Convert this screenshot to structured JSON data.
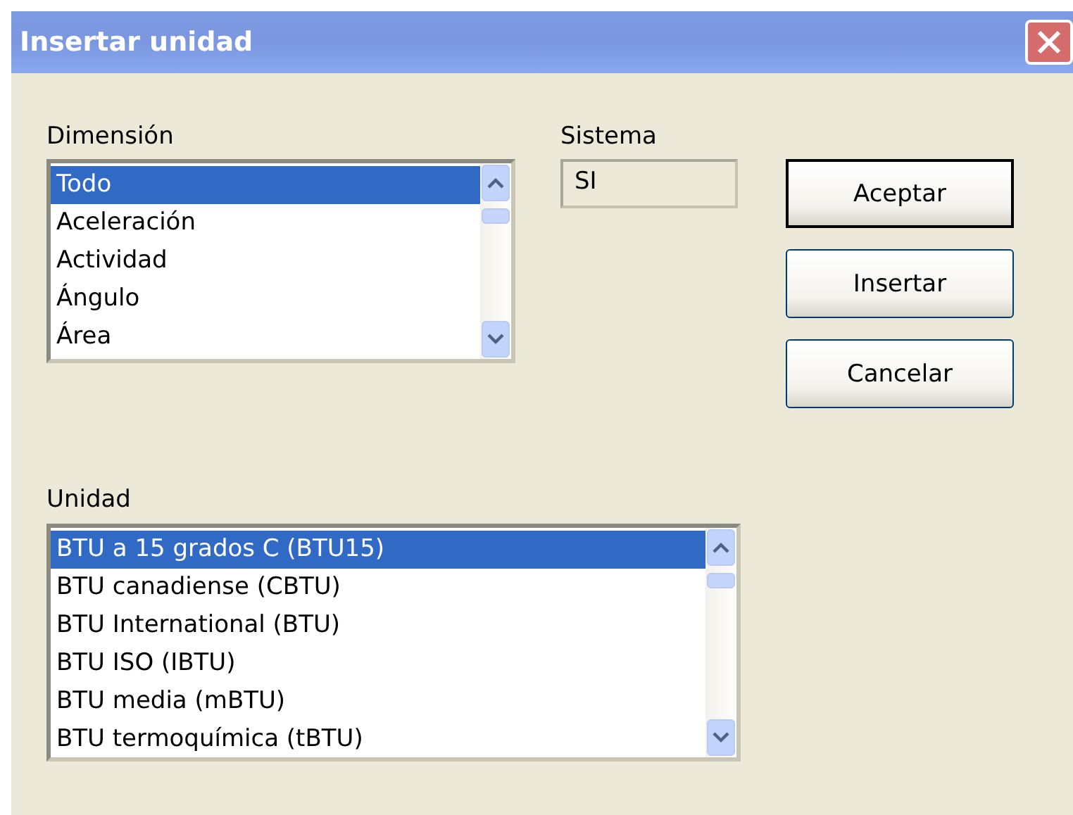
{
  "window": {
    "title": "Insertar unidad"
  },
  "dimension": {
    "label": "Dimensión",
    "items": [
      {
        "label": "Todo",
        "selected": true
      },
      {
        "label": "Aceleración",
        "selected": false
      },
      {
        "label": "Actividad",
        "selected": false
      },
      {
        "label": "Ángulo",
        "selected": false
      },
      {
        "label": "Área",
        "selected": false
      }
    ]
  },
  "system": {
    "label": "Sistema",
    "value": "SI"
  },
  "buttons": [
    {
      "label": "Aceptar",
      "default": true
    },
    {
      "label": "Insertar",
      "default": false
    },
    {
      "label": "Cancelar",
      "default": false
    }
  ],
  "unit": {
    "label": "Unidad",
    "items": [
      {
        "label": "BTU a 15 grados C (BTU15)",
        "selected": true
      },
      {
        "label": "BTU canadiense (CBTU)",
        "selected": false
      },
      {
        "label": "BTU International (BTU)",
        "selected": false
      },
      {
        "label": "BTU ISO (IBTU)",
        "selected": false
      },
      {
        "label": "BTU media (mBTU)",
        "selected": false
      },
      {
        "label": "BTU termoquímica (tBTU)",
        "selected": false
      }
    ]
  }
}
